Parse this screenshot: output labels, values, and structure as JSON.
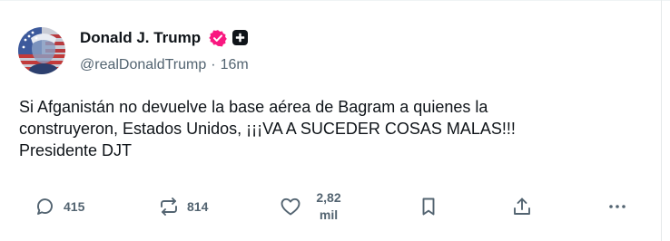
{
  "post": {
    "author_name": "Donald J. Trump",
    "handle": "@realDonaldTrump",
    "separator": "·",
    "time_ago": "16m",
    "text_lines": [
      "Si Afganistán no devuelve la base aérea de Bagram a quienes la",
      "construyeron, Estados Unidos, ¡¡¡VA A SUCEDER COSAS MALAS!!!",
      "Presidente DJT"
    ]
  },
  "actions": {
    "replies": "415",
    "reposts": "814",
    "likes_line1": "2,82",
    "likes_line2": "mil"
  },
  "colors": {
    "text": "#0f1419",
    "muted": "#536471",
    "verified_badge": "#f91880"
  },
  "icons": [
    "avatar-flag-portrait",
    "verified-badge-icon",
    "plus-badge-icon",
    "reply-icon",
    "repost-icon",
    "like-icon",
    "bookmark-icon",
    "share-icon",
    "more-icon"
  ]
}
